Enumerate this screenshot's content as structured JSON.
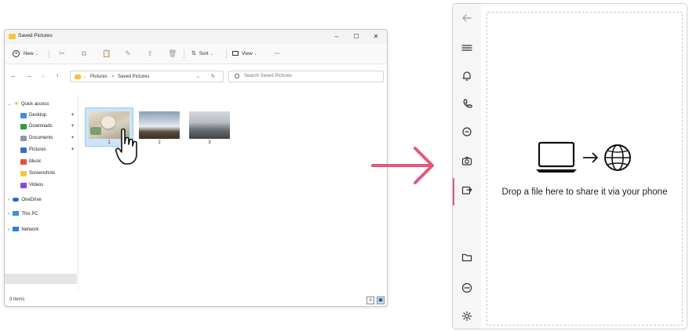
{
  "explorer": {
    "title": "Saved Pictures",
    "window_controls": {
      "minimize": "–",
      "maximize": "☐",
      "close": "✕"
    },
    "toolbar": {
      "new_label": "New",
      "sort_label": "Sort",
      "view_label": "View",
      "more_label": "···"
    },
    "address": {
      "root": "Pictures",
      "separator": ">",
      "current": "Saved Pictures",
      "search_placeholder": "Search Saved Pictures"
    },
    "nav_pane": {
      "quick_access": "Quick access",
      "pinned": [
        {
          "label": "Desktop",
          "icon": "desktop-icon",
          "color": "#3a8ee6"
        },
        {
          "label": "Downloads",
          "icon": "download-icon",
          "color": "#2e9b3e"
        },
        {
          "label": "Documents",
          "icon": "documents-icon",
          "color": "#8a98a8"
        },
        {
          "label": "Pictures",
          "icon": "pictures-icon",
          "color": "#2f6fd8"
        }
      ],
      "others": [
        {
          "label": "Music",
          "icon": "music-icon",
          "color": "#e2533b"
        },
        {
          "label": "Screenshots",
          "icon": "folder-icon",
          "color": "#f5c542"
        },
        {
          "label": "Videos",
          "icon": "videos-icon",
          "color": "#8a49d8"
        }
      ],
      "onedrive": "OneDrive",
      "this_pc": "This PC",
      "network": "Network"
    },
    "files": [
      {
        "name": "1",
        "selected": true
      },
      {
        "name": "2",
        "selected": false
      },
      {
        "name": "3",
        "selected": false
      }
    ],
    "status": "3 items"
  },
  "phone_link": {
    "drop_text": "Drop a file here to share it via your phone",
    "rail_icons": [
      "back-arrow-icon",
      "menu-icon",
      "bell-icon",
      "phone-icon",
      "message-icon",
      "camera-icon",
      "share-icon",
      "folder-icon",
      "minus-circle-icon",
      "settings-icon"
    ],
    "accent_color": "#e05a7a"
  },
  "arrow_color": "#e8567a"
}
